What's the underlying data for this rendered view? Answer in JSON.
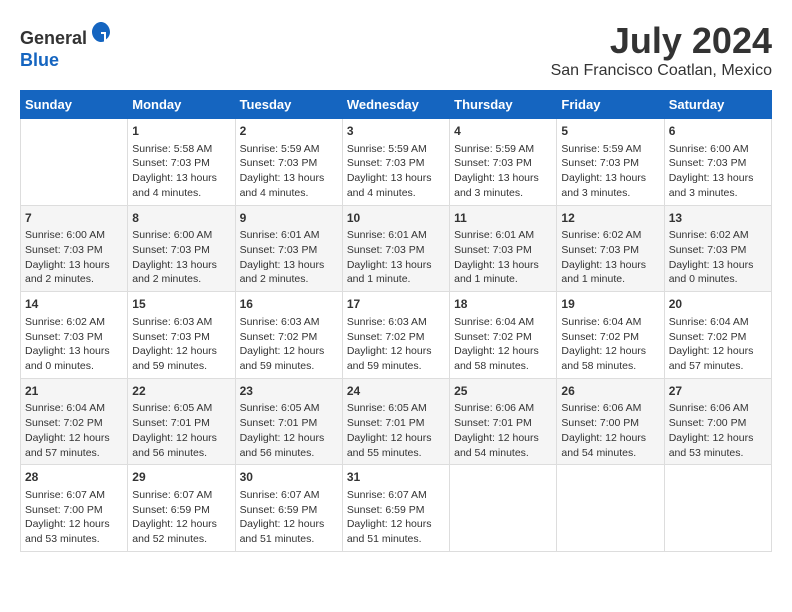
{
  "header": {
    "logo_line1": "General",
    "logo_line2": "Blue",
    "main_title": "July 2024",
    "subtitle": "San Francisco Coatlan, Mexico"
  },
  "calendar": {
    "days_of_week": [
      "Sunday",
      "Monday",
      "Tuesday",
      "Wednesday",
      "Thursday",
      "Friday",
      "Saturday"
    ],
    "weeks": [
      [
        {
          "day": "",
          "content": ""
        },
        {
          "day": "1",
          "content": "Sunrise: 5:58 AM\nSunset: 7:03 PM\nDaylight: 13 hours and 4 minutes."
        },
        {
          "day": "2",
          "content": "Sunrise: 5:59 AM\nSunset: 7:03 PM\nDaylight: 13 hours and 4 minutes."
        },
        {
          "day": "3",
          "content": "Sunrise: 5:59 AM\nSunset: 7:03 PM\nDaylight: 13 hours and 4 minutes."
        },
        {
          "day": "4",
          "content": "Sunrise: 5:59 AM\nSunset: 7:03 PM\nDaylight: 13 hours and 3 minutes."
        },
        {
          "day": "5",
          "content": "Sunrise: 5:59 AM\nSunset: 7:03 PM\nDaylight: 13 hours and 3 minutes."
        },
        {
          "day": "6",
          "content": "Sunrise: 6:00 AM\nSunset: 7:03 PM\nDaylight: 13 hours and 3 minutes."
        }
      ],
      [
        {
          "day": "7",
          "content": "Sunrise: 6:00 AM\nSunset: 7:03 PM\nDaylight: 13 hours and 2 minutes."
        },
        {
          "day": "8",
          "content": "Sunrise: 6:00 AM\nSunset: 7:03 PM\nDaylight: 13 hours and 2 minutes."
        },
        {
          "day": "9",
          "content": "Sunrise: 6:01 AM\nSunset: 7:03 PM\nDaylight: 13 hours and 2 minutes."
        },
        {
          "day": "10",
          "content": "Sunrise: 6:01 AM\nSunset: 7:03 PM\nDaylight: 13 hours and 1 minute."
        },
        {
          "day": "11",
          "content": "Sunrise: 6:01 AM\nSunset: 7:03 PM\nDaylight: 13 hours and 1 minute."
        },
        {
          "day": "12",
          "content": "Sunrise: 6:02 AM\nSunset: 7:03 PM\nDaylight: 13 hours and 1 minute."
        },
        {
          "day": "13",
          "content": "Sunrise: 6:02 AM\nSunset: 7:03 PM\nDaylight: 13 hours and 0 minutes."
        }
      ],
      [
        {
          "day": "14",
          "content": "Sunrise: 6:02 AM\nSunset: 7:03 PM\nDaylight: 13 hours and 0 minutes."
        },
        {
          "day": "15",
          "content": "Sunrise: 6:03 AM\nSunset: 7:03 PM\nDaylight: 12 hours and 59 minutes."
        },
        {
          "day": "16",
          "content": "Sunrise: 6:03 AM\nSunset: 7:02 PM\nDaylight: 12 hours and 59 minutes."
        },
        {
          "day": "17",
          "content": "Sunrise: 6:03 AM\nSunset: 7:02 PM\nDaylight: 12 hours and 59 minutes."
        },
        {
          "day": "18",
          "content": "Sunrise: 6:04 AM\nSunset: 7:02 PM\nDaylight: 12 hours and 58 minutes."
        },
        {
          "day": "19",
          "content": "Sunrise: 6:04 AM\nSunset: 7:02 PM\nDaylight: 12 hours and 58 minutes."
        },
        {
          "day": "20",
          "content": "Sunrise: 6:04 AM\nSunset: 7:02 PM\nDaylight: 12 hours and 57 minutes."
        }
      ],
      [
        {
          "day": "21",
          "content": "Sunrise: 6:04 AM\nSunset: 7:02 PM\nDaylight: 12 hours and 57 minutes."
        },
        {
          "day": "22",
          "content": "Sunrise: 6:05 AM\nSunset: 7:01 PM\nDaylight: 12 hours and 56 minutes."
        },
        {
          "day": "23",
          "content": "Sunrise: 6:05 AM\nSunset: 7:01 PM\nDaylight: 12 hours and 56 minutes."
        },
        {
          "day": "24",
          "content": "Sunrise: 6:05 AM\nSunset: 7:01 PM\nDaylight: 12 hours and 55 minutes."
        },
        {
          "day": "25",
          "content": "Sunrise: 6:06 AM\nSunset: 7:01 PM\nDaylight: 12 hours and 54 minutes."
        },
        {
          "day": "26",
          "content": "Sunrise: 6:06 AM\nSunset: 7:00 PM\nDaylight: 12 hours and 54 minutes."
        },
        {
          "day": "27",
          "content": "Sunrise: 6:06 AM\nSunset: 7:00 PM\nDaylight: 12 hours and 53 minutes."
        }
      ],
      [
        {
          "day": "28",
          "content": "Sunrise: 6:07 AM\nSunset: 7:00 PM\nDaylight: 12 hours and 53 minutes."
        },
        {
          "day": "29",
          "content": "Sunrise: 6:07 AM\nSunset: 6:59 PM\nDaylight: 12 hours and 52 minutes."
        },
        {
          "day": "30",
          "content": "Sunrise: 6:07 AM\nSunset: 6:59 PM\nDaylight: 12 hours and 51 minutes."
        },
        {
          "day": "31",
          "content": "Sunrise: 6:07 AM\nSunset: 6:59 PM\nDaylight: 12 hours and 51 minutes."
        },
        {
          "day": "",
          "content": ""
        },
        {
          "day": "",
          "content": ""
        },
        {
          "day": "",
          "content": ""
        }
      ]
    ]
  }
}
